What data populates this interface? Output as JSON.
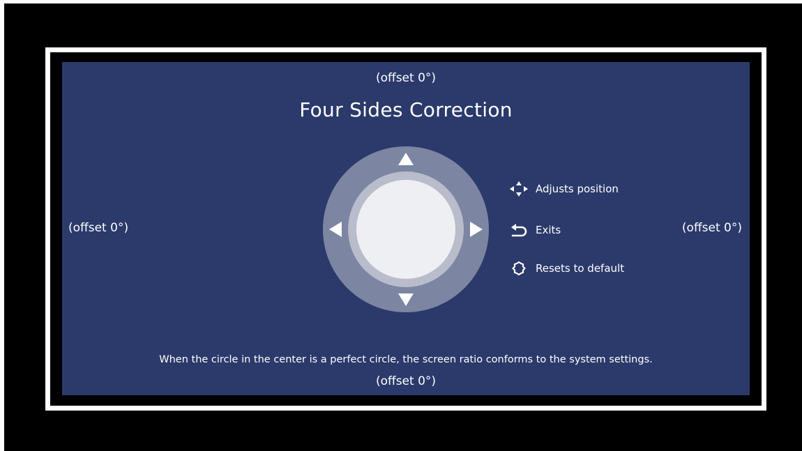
{
  "screen": {
    "title": "Four Sides Correction",
    "offsets": {
      "top": "(offset 0°)",
      "left": "(offset 0°)",
      "right": "(offset 0°)",
      "bottom": "(offset 0°)"
    },
    "hint": "When the circle in the center is a perfect circle, the screen ratio conforms to the system settings.",
    "legend": [
      {
        "icon": "four-way-arrows-icon",
        "label": "Adjusts position"
      },
      {
        "icon": "back-arrow-icon",
        "label": "Exits"
      },
      {
        "icon": "reset-gear-icon",
        "label": "Resets to default"
      }
    ],
    "colors": {
      "panel_background": "#2b3a6b",
      "dpad_outer": "#7c85a2",
      "dpad_ring": "#b9bccb",
      "dpad_center": "#eeeff2",
      "text": "#ffffff"
    }
  }
}
